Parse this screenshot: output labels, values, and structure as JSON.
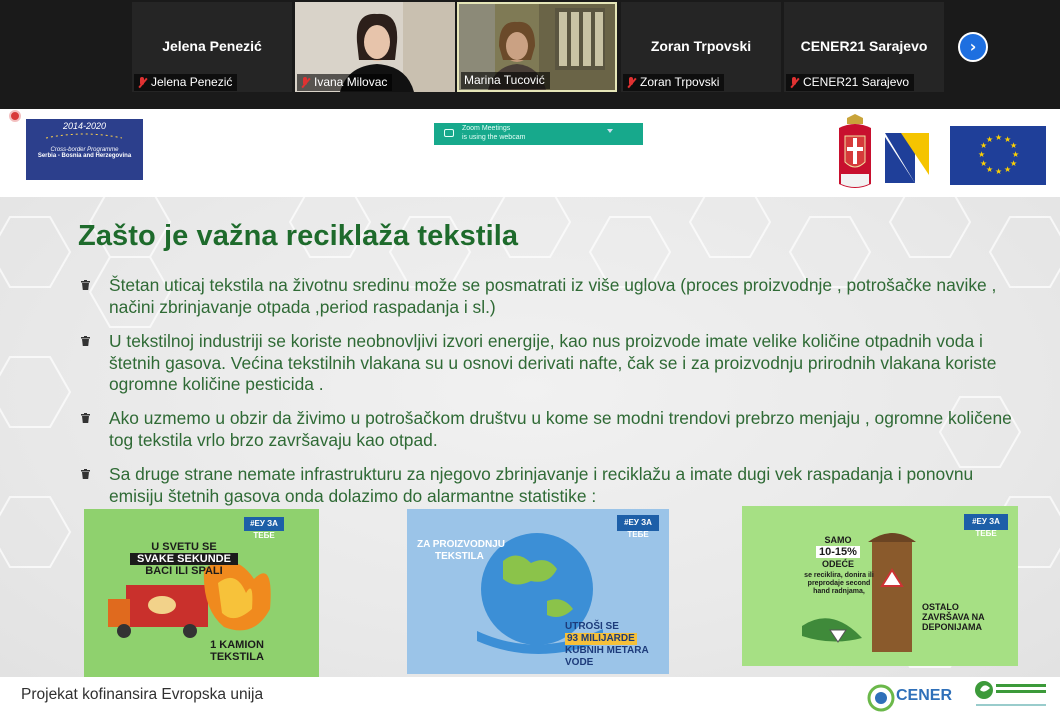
{
  "participants": [
    {
      "name": "Jelena Penezić",
      "label": "Jelena Penezić",
      "muted": true,
      "video": false
    },
    {
      "name": "Ivana Milovac",
      "label": "Ivana Milovac",
      "muted": true,
      "video": true
    },
    {
      "name": "Marina Tucović",
      "label": "Marina Tucović",
      "muted": false,
      "video": true,
      "active_speaker": true
    },
    {
      "name": "Zoran Trpovski",
      "label": "Zoran Trpovski",
      "muted": true,
      "video": false
    },
    {
      "name": "CENER21 Sarajevo",
      "label": "CENER21 Sarajevo",
      "muted": true,
      "video": false
    }
  ],
  "strip_next_icon": "chevron-right-icon",
  "program_logo": {
    "years": "2014-2020",
    "programme": "Cross-border Programme",
    "countries": "Serbia - Bosnia and Herzegovina"
  },
  "webcam_notice": {
    "line1": "Zoom Meetings",
    "line2": "is using the webcam"
  },
  "slide": {
    "title": "Zašto je važna reciklaža tekstila",
    "bullet_icon": "trash-icon",
    "bullets": [
      "Štetan uticaj tekstila na životnu sredinu može se posmatrati iz više  uglova (proces proizvodnje , potrošačke navike , načini  zbrinjavanje otpada ,period raspadanja i sl.)",
      "U tekstilnoj industriji se koriste neobnovljivi izvori energije, kao nus proizvode imate velike količine otpadnih voda i štetnih gasova. Većina tekstilnih vlakana su u osnovi derivati nafte, čak se i za proizvodnju prirodnih vlakana koriste ogromne količine pesticida .",
      "Ako uzmemo u obzir da živimo u potrošačkom društvu u kome se modni trendovi prebrzo menjaju , ogromne količene tog tekstila vrlo brzo završavaju kao otpad.",
      "Sa druge strane nemate infrastrukturu za njegovo zbrinjavanje i reciklažu a imate   dugi vek raspadanja i ponovnu emisiju štetnih gasova onda dolazimo do alarmantne statistike :"
    ],
    "posters": [
      {
        "tag": "#ЕУ ЗА ТЕБЕ",
        "headline_lines": [
          "U SVETU SE",
          "SVAKE SEKUNDE",
          "BACI ILI SPALI"
        ],
        "footer_lines": [
          "1 KAMION",
          "TEKSTILA"
        ]
      },
      {
        "tag": "#ЕУ ЗА ТЕБЕ",
        "headline_lines": [
          "ZA PROIZVODNJU",
          "TEKSTILA"
        ],
        "footer_lines": [
          "UTROŠI SE",
          "93 MILIJARDE",
          "KUBNIH METARA",
          "VODE"
        ]
      },
      {
        "tag": "#ЕУ ЗА ТЕБЕ",
        "headline_lines": [
          "SAMO",
          "10-15%",
          "ODEĆE"
        ],
        "detail_lines": [
          "se reciklira, donira ili",
          "preprodaje second",
          "hand radnjama,"
        ],
        "footer_lines": [
          "OSTALO",
          "ZAVRŠAVA NA",
          "DEPONIJAMA"
        ]
      }
    ],
    "footer_text": "Projekat kofinansira Evropska unija",
    "cener_logo_text": "CENER",
    "colors": {
      "title_green": "#1e6b2c",
      "body_green": "#2f6a35",
      "poster1_bg": "#8fd16e",
      "poster2_bg": "#9bc4e8",
      "poster3_bg": "#a6e084",
      "eu_blue": "#1f3f99"
    }
  }
}
